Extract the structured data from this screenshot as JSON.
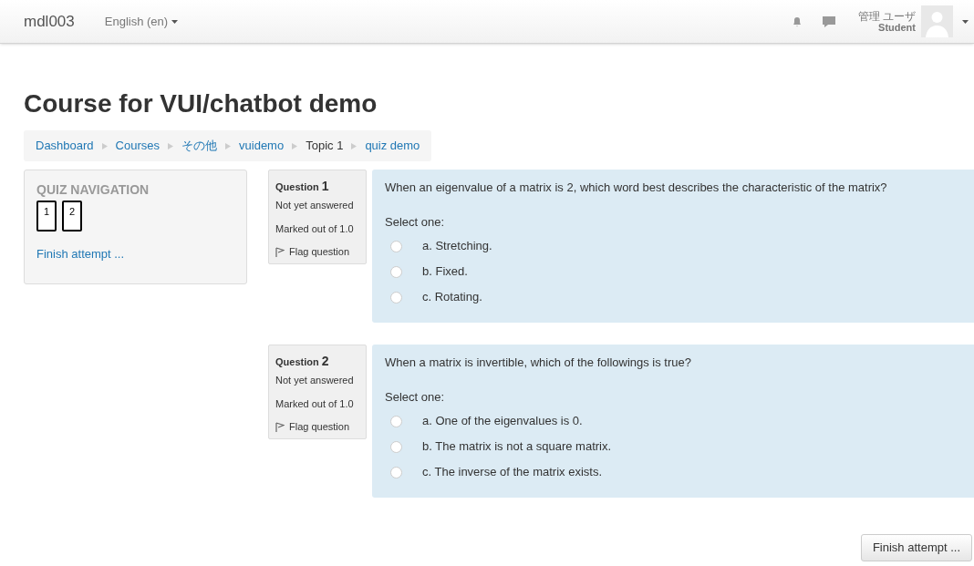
{
  "navbar": {
    "site_name": "mdl003",
    "language": "English (en)",
    "user_name": "管理 ユーザ",
    "user_role": "Student"
  },
  "page_title": "Course for VUI/chatbot demo",
  "breadcrumb": [
    {
      "label": "Dashboard",
      "kind": "link"
    },
    {
      "label": "Courses",
      "kind": "link"
    },
    {
      "label": "その他",
      "kind": "link"
    },
    {
      "label": "vuidemo",
      "kind": "link"
    },
    {
      "label": "Topic 1",
      "kind": "text"
    },
    {
      "label": "quiz demo",
      "kind": "link"
    }
  ],
  "quiz_navigation": {
    "title": "QUIZ NAVIGATION",
    "buttons": [
      {
        "label": "1"
      },
      {
        "label": "2"
      }
    ],
    "finish_link": "Finish attempt ..."
  },
  "questions": [
    {
      "label": "Question",
      "number": "1",
      "status": "Not yet answered",
      "marks": "Marked out of 1.0",
      "flag": "Flag question",
      "text": "When an eigenvalue of a matrix is 2, which word best describes the characteristic of the matrix?",
      "prompt": "Select one:",
      "options": [
        {
          "label": "a. Stretching.",
          "selected": false
        },
        {
          "label": "b. Fixed.",
          "selected": false
        },
        {
          "label": "c. Rotating.",
          "selected": false
        }
      ]
    },
    {
      "label": "Question",
      "number": "2",
      "status": "Not yet answered",
      "marks": "Marked out of 1.0",
      "flag": "Flag question",
      "text": "When a matrix is invertible, which of the followings is true?",
      "prompt": "Select one:",
      "options": [
        {
          "label": "a. One of the eigenvalues is 0.",
          "selected": false
        },
        {
          "label": "b. The matrix is not a square matrix.",
          "selected": false
        },
        {
          "label": "c. The inverse of the matrix exists.",
          "selected": false
        }
      ]
    }
  ],
  "finish_button": "Finish attempt ..."
}
